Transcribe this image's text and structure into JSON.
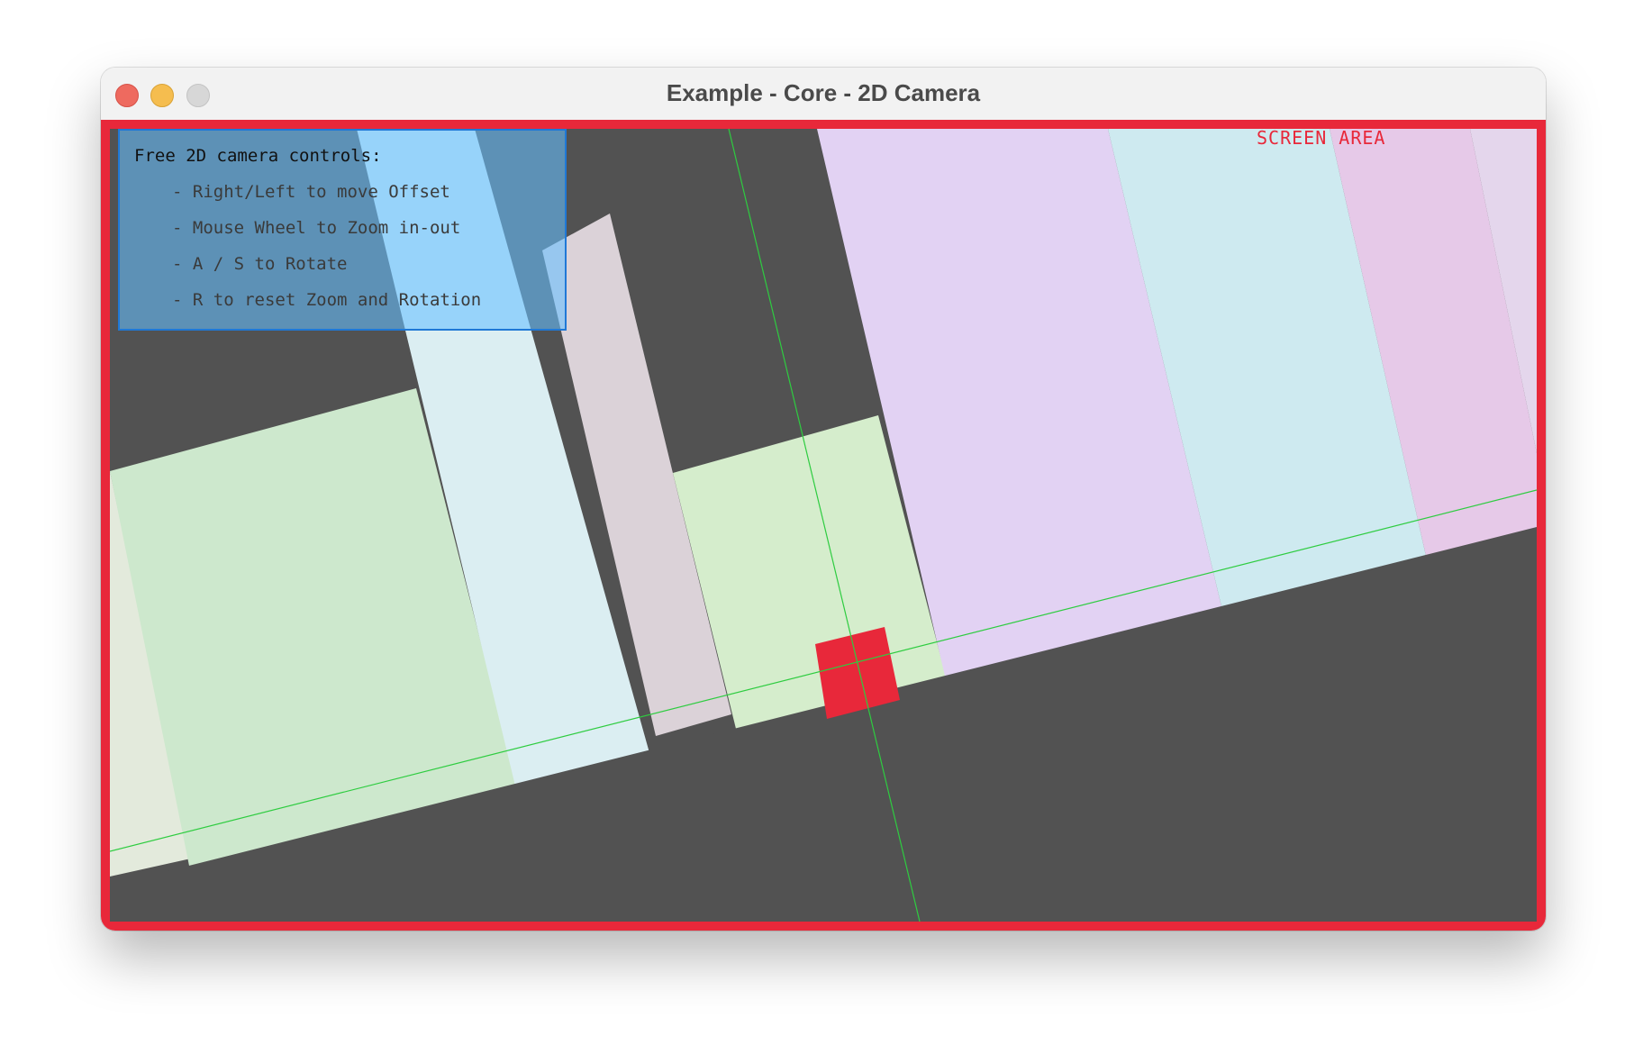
{
  "window": {
    "title": "Example - Core - 2D Camera"
  },
  "overlay": {
    "help_title": "Free 2D camera controls:",
    "help_items": [
      "- Right/Left to move Offset",
      "- Mouse Wheel to Zoom in-out",
      "- A / S to Rotate",
      "- R to reset Zoom and Rotation"
    ],
    "screen_area_label": "SCREEN AREA"
  },
  "colors": {
    "frame_red": "#e8283a",
    "ground_gray": "#525252",
    "crosshair_green": "#2ecc40",
    "player_red": "#e8283a",
    "help_box_fill": "#66bfff",
    "help_box_border": "#1f78d6"
  },
  "scene": {
    "player": "red-square",
    "buildings": [
      "light-green",
      "light-blue",
      "dusty-pink",
      "pale-green",
      "lavender",
      "pale-cyan",
      "pink",
      "light-lavender"
    ]
  }
}
